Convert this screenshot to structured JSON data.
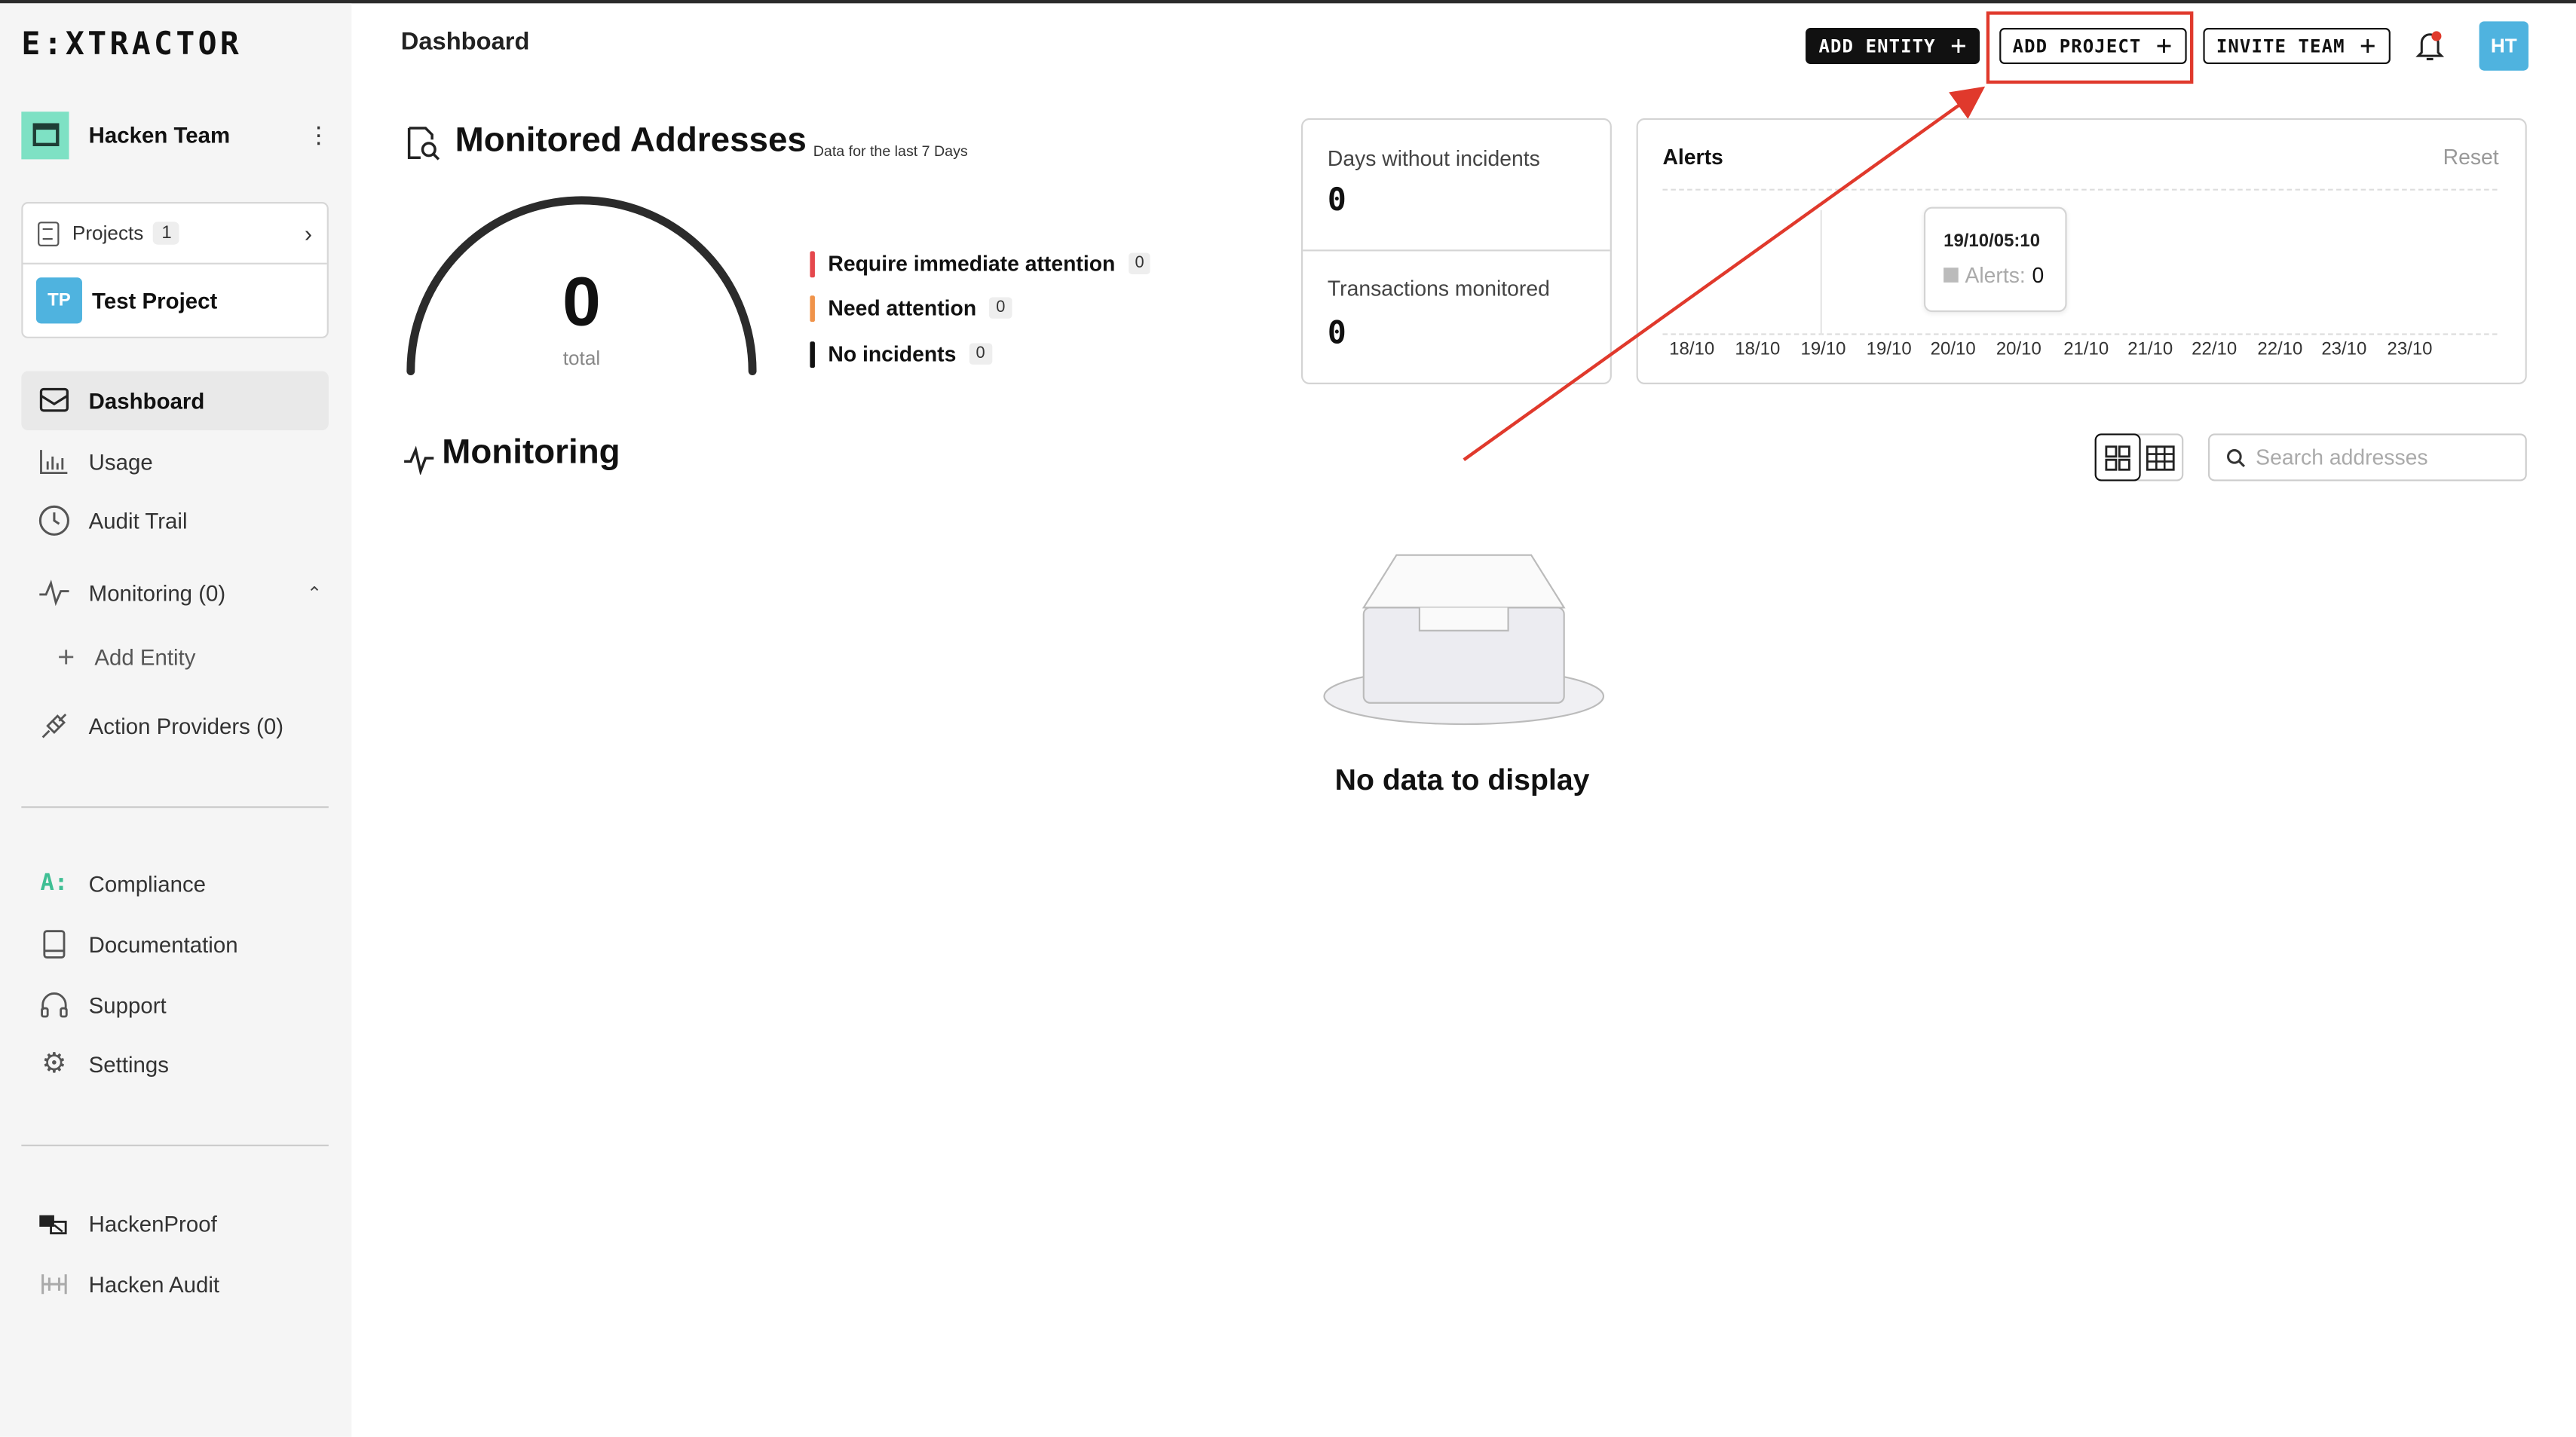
{
  "app": {
    "logo": "E:XTRACTOR",
    "page_title": "Dashboard"
  },
  "sidebar": {
    "team": {
      "name": "Hacken Team",
      "menu_icon": "kebab-icon"
    },
    "projects": {
      "label": "Projects",
      "count": "1",
      "items": [
        {
          "initials": "TP",
          "name": "Test Project"
        }
      ]
    },
    "nav": [
      {
        "label": "Dashboard",
        "icon": "dashboard-icon",
        "active": true
      },
      {
        "label": "Usage",
        "icon": "bar-chart-icon"
      },
      {
        "label": "Audit Trail",
        "icon": "clock-icon"
      },
      {
        "label": "Monitoring (0)",
        "icon": "pulse-icon",
        "expanded": true
      },
      {
        "label": "Action Providers (0)",
        "icon": "plug-icon"
      }
    ],
    "sub_nav": {
      "add_entity": "Add Entity"
    },
    "secondary": [
      {
        "label": "Compliance",
        "icon": "compliance-icon"
      },
      {
        "label": "Documentation",
        "icon": "book-icon"
      },
      {
        "label": "Support",
        "icon": "headphones-icon"
      },
      {
        "label": "Settings",
        "icon": "gear-icon"
      }
    ],
    "external": [
      {
        "label": "HackenProof",
        "icon": "hackenproof-icon"
      },
      {
        "label": "Hacken Audit",
        "icon": "hacken-audit-icon"
      }
    ]
  },
  "header": {
    "add_entity": "ADD ENTITY",
    "add_project": "ADD PROJECT",
    "invite_team": "INVITE TEAM",
    "avatar": "HT"
  },
  "monitored": {
    "title": "Monitored Addresses",
    "subtitle": "Data for the last 7 Days",
    "total_value": "0",
    "total_label": "total",
    "legend": [
      {
        "label": "Require immediate attention",
        "count": "0",
        "color": "#e5484d"
      },
      {
        "label": "Need attention",
        "count": "0",
        "color": "#f0934a"
      },
      {
        "label": "No incidents",
        "count": "0",
        "color": "#111111"
      }
    ]
  },
  "stats": {
    "days_without_incidents_label": "Days without incidents",
    "days_without_incidents_value": "0",
    "transactions_monitored_label": "Transactions monitored",
    "transactions_monitored_value": "0"
  },
  "alerts": {
    "title": "Alerts",
    "reset": "Reset",
    "tooltip": {
      "date": "19/10/05:10",
      "label": "Alerts:",
      "value": "0"
    },
    "x_ticks": [
      "18/10",
      "18/10",
      "19/10",
      "19/10",
      "20/10",
      "20/10",
      "21/10",
      "21/10",
      "22/10",
      "22/10",
      "23/10",
      "23/10"
    ]
  },
  "monitoring": {
    "title": "Monitoring",
    "search_placeholder": "Search addresses",
    "empty_text": "No data to display"
  },
  "colors": {
    "accent_teal": "#7ee1c4",
    "avatar_blue": "#4fb3df",
    "highlight_red": "#e0392c"
  }
}
